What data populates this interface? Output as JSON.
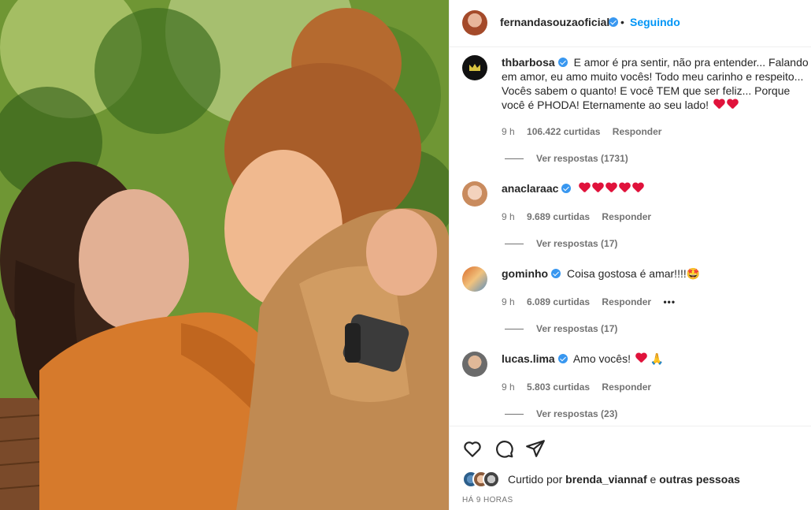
{
  "post": {
    "author": "fernandasouzaoficial",
    "separator": "•",
    "follow_status": "Seguindo"
  },
  "comments": [
    {
      "username": "thbarbosa",
      "text": "E amor é pra sentir, não pra entender... Falando em amor, eu amo muito vocês! Todo meu carinho e respeito... Vocês sabem o quanto! E você TEM que ser feliz... Porque você é PHODA! Eternamente ao seu lado!",
      "time": "9 h",
      "likes": "106.422 curtidas",
      "reply": "Responder",
      "view_replies": "Ver respostas (1731)",
      "hearts": 2
    },
    {
      "username": "anaclaraac",
      "text": "",
      "time": "9 h",
      "likes": "9.689 curtidas",
      "reply": "Responder",
      "view_replies": "Ver respostas (17)",
      "hearts": 5
    },
    {
      "username": "gominho",
      "text": "Coisa gostosa é amar!!!!🤩",
      "time": "9 h",
      "likes": "6.089 curtidas",
      "reply": "Responder",
      "more": "•••",
      "view_replies": "Ver respostas (17)"
    },
    {
      "username": "lucas.lima",
      "text": "Amo vocês!",
      "emoji_after": "🙏",
      "time": "9 h",
      "likes": "5.803 curtidas",
      "reply": "Responder",
      "view_replies": "Ver respostas (23)",
      "hearts": 1
    }
  ],
  "actions": {
    "like_icon": "heart-outline-icon",
    "comment_icon": "comment-icon",
    "share_icon": "send-icon"
  },
  "likes_summary": {
    "prefix": "Curtido por",
    "user": "brenda_viannaf",
    "conjunction": "e",
    "others": "outras pessoas"
  },
  "time_ago": "HÁ 9 HORAS",
  "colors": {
    "accent": "#0095f6",
    "verified": "#3897f0",
    "heart": "#e0123b",
    "muted": "#737373"
  }
}
